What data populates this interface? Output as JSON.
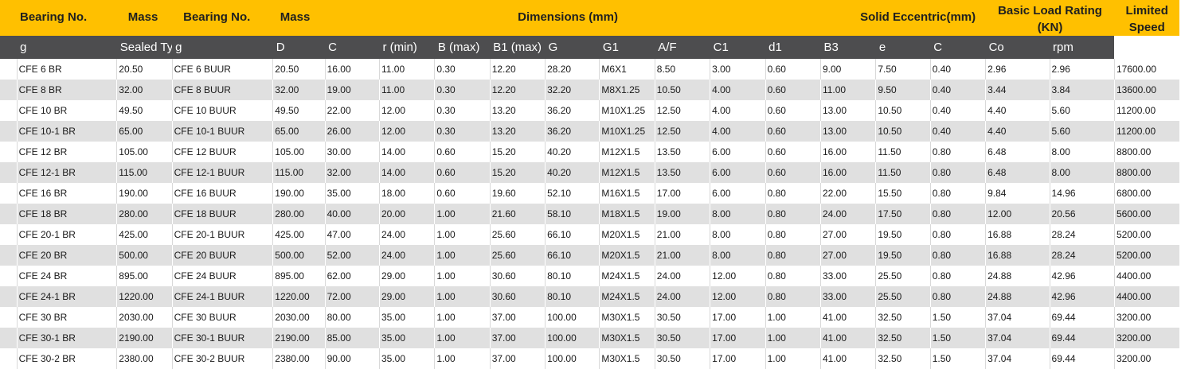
{
  "header_top": {
    "bearing_no": "Bearing No.",
    "mass": "Mass",
    "bearing_no_2": "Bearing No.",
    "mass_2": "Mass",
    "dimensions": "Dimensions (mm)",
    "solid_eccentric": "Solid Eccentric(mm)",
    "basic_load_rating": "Basic Load Rating",
    "basic_load_rating_unit": "(KN)",
    "limited": "Limited",
    "speed": "Speed"
  },
  "header_sub": [
    "",
    "g",
    "Sealed Type",
    "g",
    "D",
    "C",
    "r (min)",
    "B (max)",
    "B1 (max)",
    "G",
    "G1",
    "A/F",
    "C1",
    "d1",
    "B3",
    "e",
    "C",
    "Co",
    "rpm"
  ],
  "rows": [
    [
      "",
      "CFE 6 BR",
      "20.50",
      "CFE 6 BUUR",
      "20.50",
      "16.00",
      "11.00",
      "0.30",
      "12.20",
      "28.20",
      "M6X1",
      "8.50",
      "3.00",
      "0.60",
      "9.00",
      "7.50",
      "0.40",
      "2.96",
      "2.96",
      "17600.00"
    ],
    [
      "",
      "CFE 8 BR",
      "32.00",
      "CFE 8 BUUR",
      "32.00",
      "19.00",
      "11.00",
      "0.30",
      "12.20",
      "32.20",
      "M8X1.25",
      "10.50",
      "4.00",
      "0.60",
      "11.00",
      "9.50",
      "0.40",
      "3.44",
      "3.84",
      "13600.00"
    ],
    [
      "",
      "CFE 10 BR",
      "49.50",
      "CFE 10 BUUR",
      "49.50",
      "22.00",
      "12.00",
      "0.30",
      "13.20",
      "36.20",
      "M10X1.25",
      "12.50",
      "4.00",
      "0.60",
      "13.00",
      "10.50",
      "0.40",
      "4.40",
      "5.60",
      "11200.00"
    ],
    [
      "",
      "CFE 10-1 BR",
      "65.00",
      "CFE 10-1 BUUR",
      "65.00",
      "26.00",
      "12.00",
      "0.30",
      "13.20",
      "36.20",
      "M10X1.25",
      "12.50",
      "4.00",
      "0.60",
      "13.00",
      "10.50",
      "0.40",
      "4.40",
      "5.60",
      "11200.00"
    ],
    [
      "",
      "CFE 12 BR",
      "105.00",
      "CFE 12 BUUR",
      "105.00",
      "30.00",
      "14.00",
      "0.60",
      "15.20",
      "40.20",
      "M12X1.5",
      "13.50",
      "6.00",
      "0.60",
      "16.00",
      "11.50",
      "0.80",
      "6.48",
      "8.00",
      "8800.00"
    ],
    [
      "",
      "CFE 12-1 BR",
      "115.00",
      "CFE 12-1 BUUR",
      "115.00",
      "32.00",
      "14.00",
      "0.60",
      "15.20",
      "40.20",
      "M12X1.5",
      "13.50",
      "6.00",
      "0.60",
      "16.00",
      "11.50",
      "0.80",
      "6.48",
      "8.00",
      "8800.00"
    ],
    [
      "",
      "CFE 16 BR",
      "190.00",
      "CFE 16 BUUR",
      "190.00",
      "35.00",
      "18.00",
      "0.60",
      "19.60",
      "52.10",
      "M16X1.5",
      "17.00",
      "6.00",
      "0.80",
      "22.00",
      "15.50",
      "0.80",
      "9.84",
      "14.96",
      "6800.00"
    ],
    [
      "",
      "CFE 18 BR",
      "280.00",
      "CFE 18 BUUR",
      "280.00",
      "40.00",
      "20.00",
      "1.00",
      "21.60",
      "58.10",
      "M18X1.5",
      "19.00",
      "8.00",
      "0.80",
      "24.00",
      "17.50",
      "0.80",
      "12.00",
      "20.56",
      "5600.00"
    ],
    [
      "",
      "CFE 20-1 BR",
      "425.00",
      "CFE 20-1 BUUR",
      "425.00",
      "47.00",
      "24.00",
      "1.00",
      "25.60",
      "66.10",
      "M20X1.5",
      "21.00",
      "8.00",
      "0.80",
      "27.00",
      "19.50",
      "0.80",
      "16.88",
      "28.24",
      "5200.00"
    ],
    [
      "",
      "CFE 20 BR",
      "500.00",
      "CFE 20 BUUR",
      "500.00",
      "52.00",
      "24.00",
      "1.00",
      "25.60",
      "66.10",
      "M20X1.5",
      "21.00",
      "8.00",
      "0.80",
      "27.00",
      "19.50",
      "0.80",
      "16.88",
      "28.24",
      "5200.00"
    ],
    [
      "",
      "CFE 24 BR",
      "895.00",
      "CFE 24 BUUR",
      "895.00",
      "62.00",
      "29.00",
      "1.00",
      "30.60",
      "80.10",
      "M24X1.5",
      "24.00",
      "12.00",
      "0.80",
      "33.00",
      "25.50",
      "0.80",
      "24.88",
      "42.96",
      "4400.00"
    ],
    [
      "",
      "CFE 24-1 BR",
      "1220.00",
      "CFE 24-1 BUUR",
      "1220.00",
      "72.00",
      "29.00",
      "1.00",
      "30.60",
      "80.10",
      "M24X1.5",
      "24.00",
      "12.00",
      "0.80",
      "33.00",
      "25.50",
      "0.80",
      "24.88",
      "42.96",
      "4400.00"
    ],
    [
      "",
      "CFE 30 BR",
      "2030.00",
      "CFE 30 BUUR",
      "2030.00",
      "80.00",
      "35.00",
      "1.00",
      "37.00",
      "100.00",
      "M30X1.5",
      "30.50",
      "17.00",
      "1.00",
      "41.00",
      "32.50",
      "1.50",
      "37.04",
      "69.44",
      "3200.00"
    ],
    [
      "",
      "CFE 30-1 BR",
      "2190.00",
      "CFE 30-1 BUUR",
      "2190.00",
      "85.00",
      "35.00",
      "1.00",
      "37.00",
      "100.00",
      "M30X1.5",
      "30.50",
      "17.00",
      "1.00",
      "41.00",
      "32.50",
      "1.50",
      "37.04",
      "69.44",
      "3200.00"
    ],
    [
      "",
      "CFE 30-2 BR",
      "2380.00",
      "CFE 30-2 BUUR",
      "2380.00",
      "90.00",
      "35.00",
      "1.00",
      "37.00",
      "100.00",
      "M30X1.5",
      "30.50",
      "17.00",
      "1.00",
      "41.00",
      "32.50",
      "1.50",
      "37.04",
      "69.44",
      "3200.00"
    ]
  ],
  "colors": {
    "header_bg": "#FFC000",
    "subheader_bg": "#4D4D4F",
    "row_alt_bg": "#E0E0E0"
  }
}
